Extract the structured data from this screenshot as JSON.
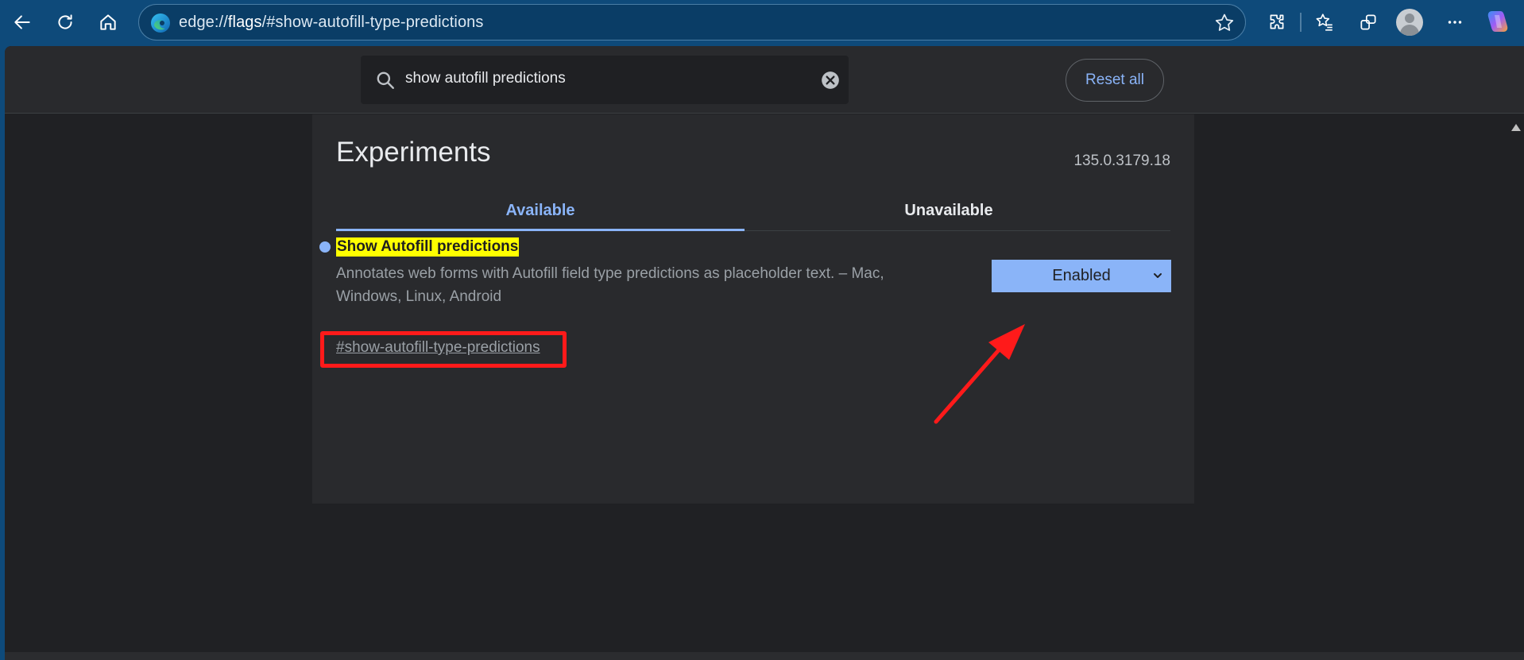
{
  "browser": {
    "url_prefix": "edge://",
    "url_host": "flags",
    "url_path": "/#show-autofill-type-predictions"
  },
  "header": {
    "search_value": "show autofill predictions",
    "reset_label": "Reset all"
  },
  "main": {
    "title": "Experiments",
    "version": "135.0.3179.18",
    "tabs": [
      {
        "label": "Available",
        "active": true
      },
      {
        "label": "Unavailable",
        "active": false
      }
    ]
  },
  "flag": {
    "name": "Show Autofill predictions",
    "description": "Annotates web forms with Autofill field type predictions as placeholder text. – Mac, Windows, Linux, Android",
    "link": "#show-autofill-type-predictions",
    "selected_option": "Enabled"
  },
  "icons": {
    "back": "back-arrow-icon",
    "refresh": "refresh-icon",
    "home": "home-icon",
    "favorite": "star-icon",
    "extensions": "puzzle-icon",
    "favorites": "favorites-list-icon",
    "collections": "collections-icon",
    "more": "ellipsis-icon",
    "copilot": "copilot-icon"
  },
  "colors": {
    "accent": "#8ab4f8",
    "highlight": "#ffff00",
    "annotation": "#ff1a1a"
  }
}
